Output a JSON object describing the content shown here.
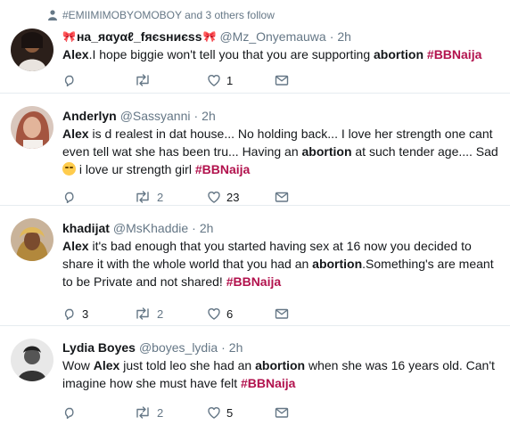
{
  "social_context": {
    "text": "#EMIIMIMOBYOMOBOY and 3 others follow"
  },
  "tweets": [
    {
      "name": "на_яαуαℓ_fяєѕниєѕѕ",
      "handle": "@Mz_Onyemauwa",
      "time": "2h",
      "segments": [
        {
          "t": "Alex",
          "b": true
        },
        {
          "t": ".I hope biggie won't tell you that you are supporting "
        },
        {
          "t": "abortion",
          "b": true
        },
        {
          "t": "  "
        },
        {
          "t": "#BBNaija",
          "tag": true
        }
      ],
      "replies": "",
      "retweets": "",
      "likes": "1"
    },
    {
      "name": "Anderlyn",
      "handle": "@Sassyanni",
      "time": "2h",
      "segments": [
        {
          "t": "Alex",
          "b": true
        },
        {
          "t": " is d realest in dat house... No holding back... I love her strength one cant even tell wat she has been tru... Having an "
        },
        {
          "t": "abortion",
          "b": true
        },
        {
          "t": " at such tender age.... Sad "
        },
        {
          "emoji": "relieved-face"
        },
        {
          "t": " i love ur strength girl  "
        },
        {
          "t": "#BBNaija",
          "tag": true
        }
      ],
      "replies": "",
      "retweets": "2",
      "likes": "23"
    },
    {
      "name": "khadijat",
      "handle": "@MsKhaddie",
      "time": "2h",
      "segments": [
        {
          "t": "Alex",
          "b": true
        },
        {
          "t": " it's bad enough that you started having sex at 16 now you decided to share it with the whole world that you had an "
        },
        {
          "t": "abortion",
          "b": true
        },
        {
          "t": ".Something's are meant to be Private and not shared! "
        },
        {
          "t": "#BBNaija",
          "tag": true
        }
      ],
      "replies": "3",
      "retweets": "2",
      "likes": "6"
    },
    {
      "name": "Lydia Boyes",
      "handle": "@boyes_lydia",
      "time": "2h",
      "segments": [
        {
          "t": "Wow "
        },
        {
          "t": "Alex",
          "b": true
        },
        {
          "t": " just told leo she had an "
        },
        {
          "t": "abortion",
          "b": true
        },
        {
          "t": " when she was 16 years old. Can't imagine how she must have felt "
        },
        {
          "t": "#BBNaija",
          "tag": true
        }
      ],
      "replies": "",
      "retweets": "2",
      "likes": "5"
    }
  ],
  "colors": {
    "hashtag": "#b2124d",
    "muted": "#657786",
    "border": "#e6ecf0"
  }
}
